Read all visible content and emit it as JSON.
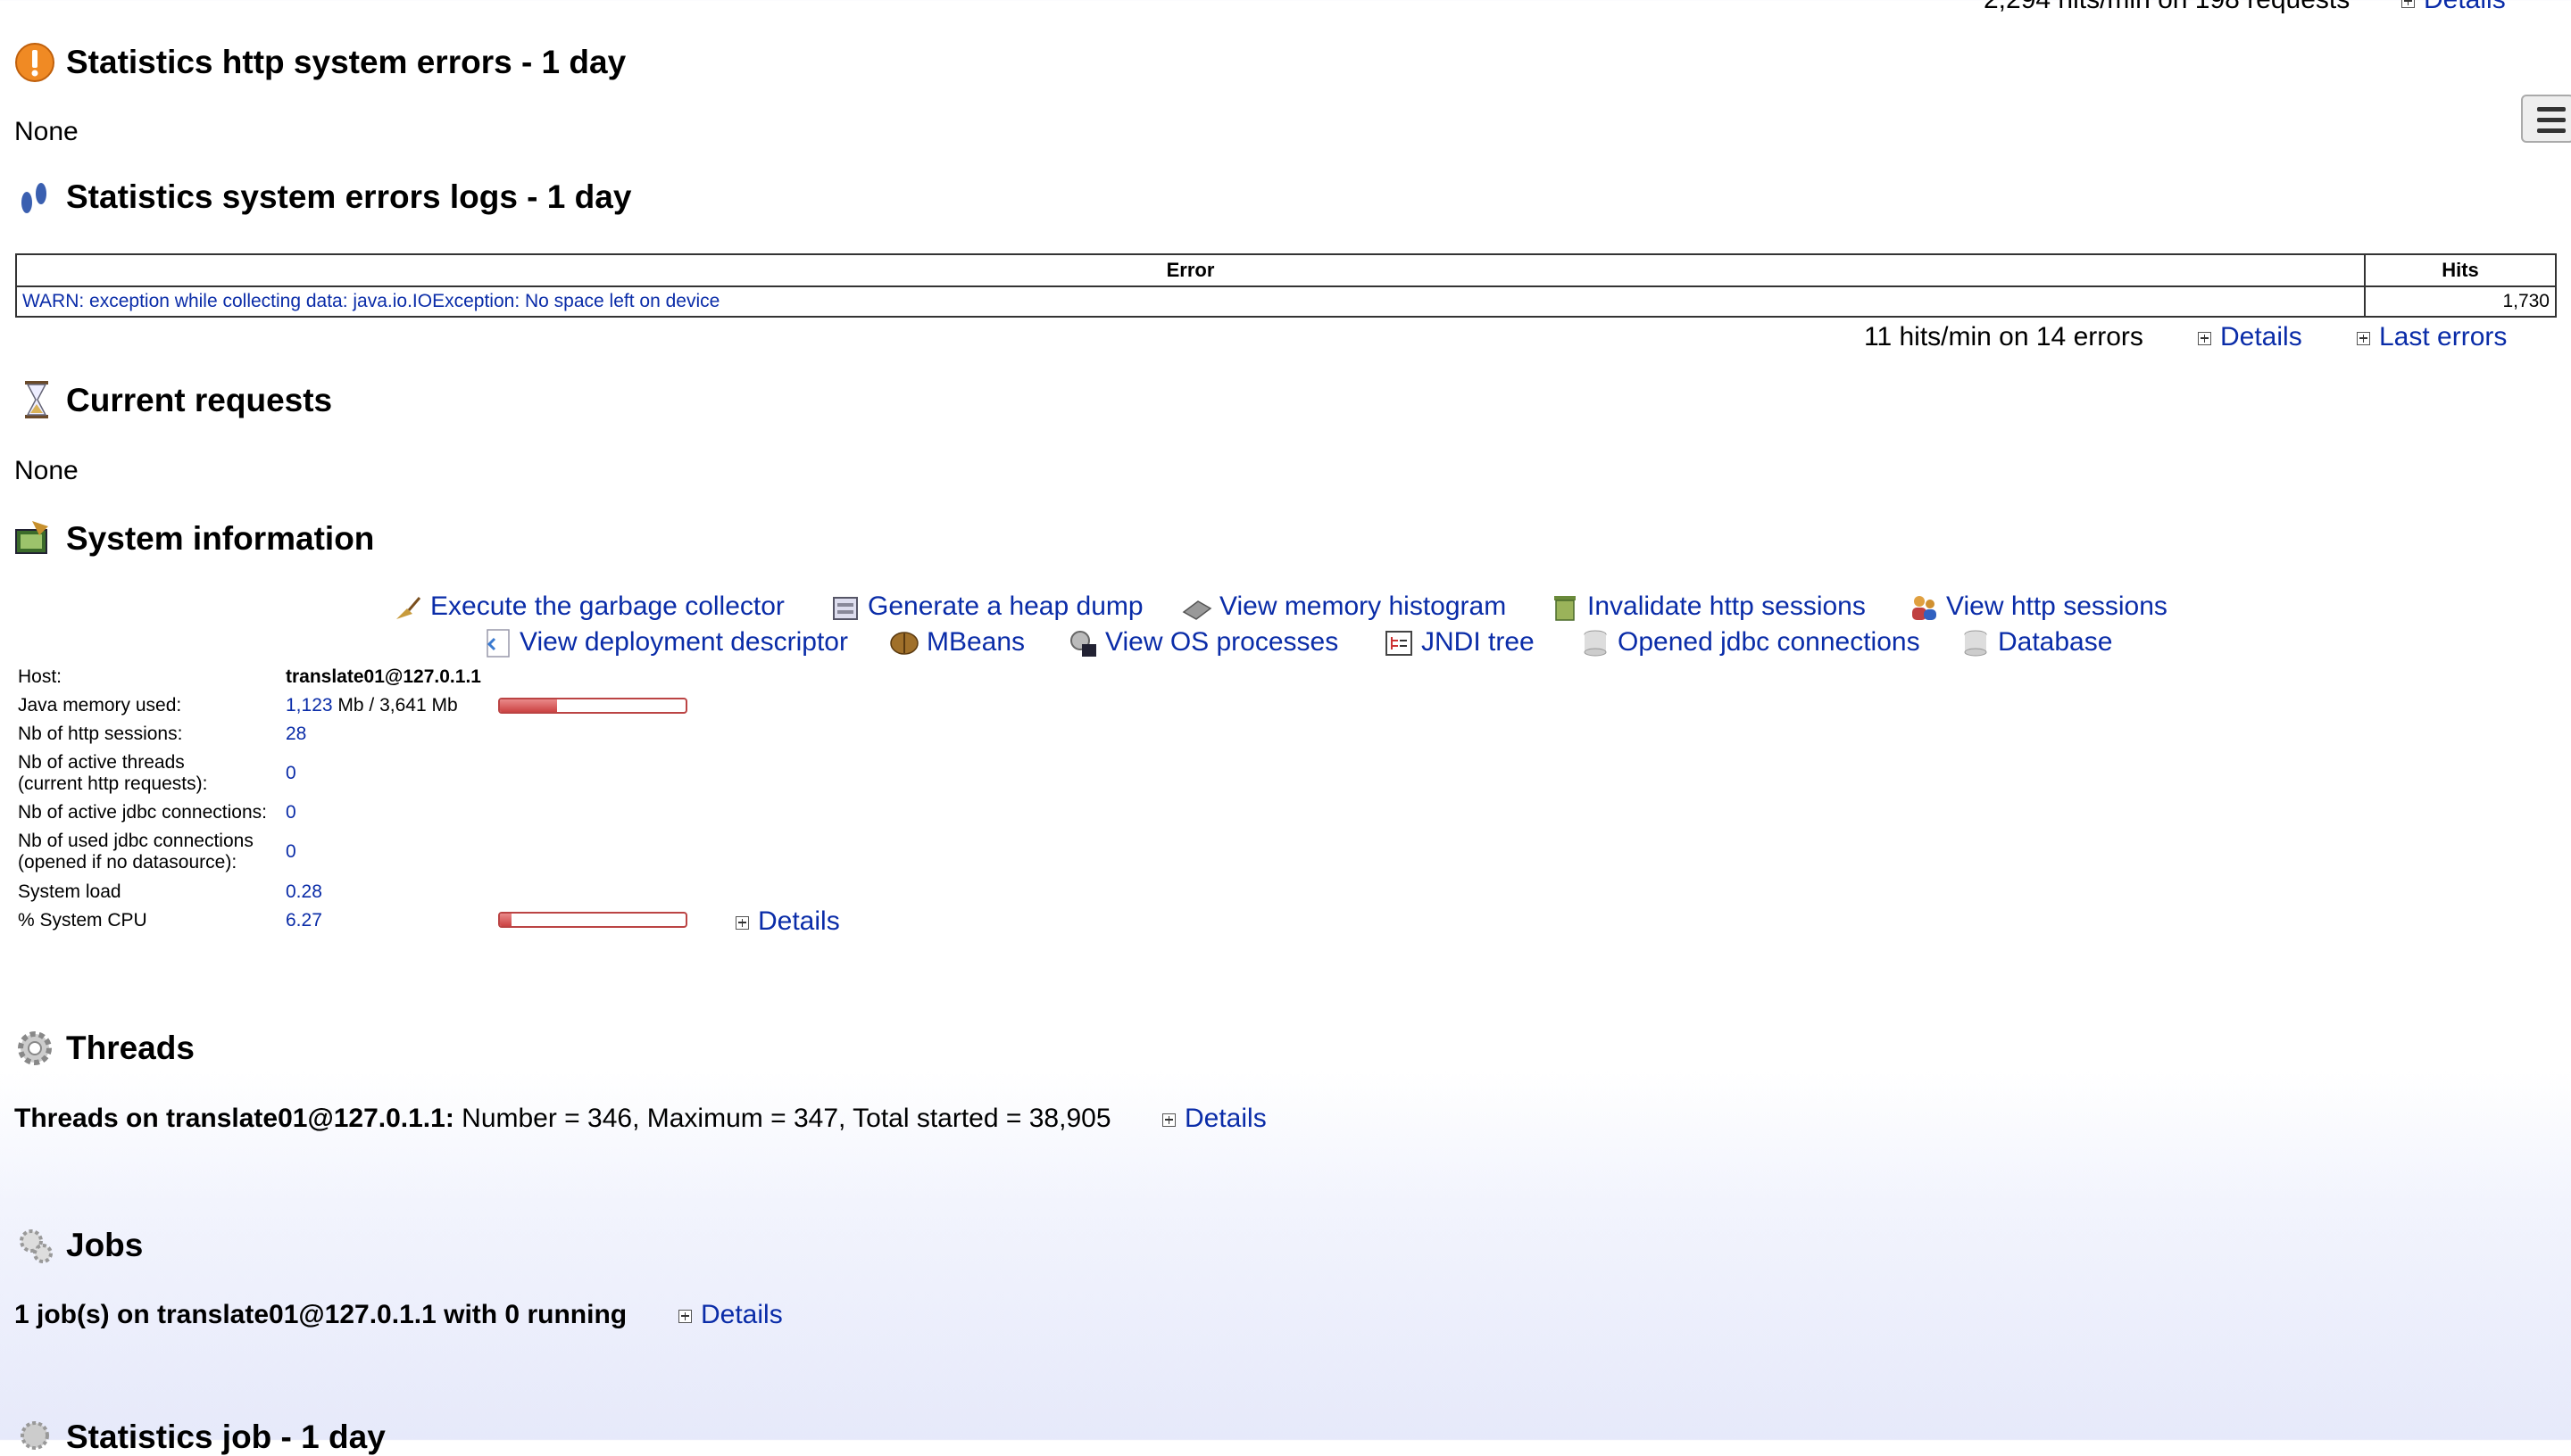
{
  "top": {
    "summary": "2,294 hits/min on 198 requests",
    "details": "Details"
  },
  "http_errors": {
    "title": "Statistics http system errors - 1 day",
    "body": "None"
  },
  "error_logs": {
    "title": "Statistics system errors logs - 1 day",
    "headers": {
      "error": "Error",
      "hits": "Hits"
    },
    "rows": [
      {
        "error": "WARN: exception while collecting data: java.io.IOException: No space left on device",
        "hits": "1,730"
      }
    ],
    "summary": "11 hits/min on 14 errors",
    "details": "Details",
    "last_errors": "Last errors"
  },
  "current_requests": {
    "title": "Current requests",
    "body": "None"
  },
  "system_info": {
    "title": "System information",
    "actions_row1": [
      "Execute the garbage collector",
      "Generate a heap dump",
      "View memory histogram",
      "Invalidate http sessions",
      "View http sessions"
    ],
    "actions_row2": [
      "View deployment descriptor",
      "MBeans",
      "View OS processes",
      "JNDI tree",
      "Opened jdbc connections",
      "Database"
    ],
    "host_label": "Host:",
    "host_value": "translate01@127.0.1.1",
    "mem_label": "Java memory used:",
    "mem_used": "1,123",
    "mem_total": " Mb / 3,641 Mb",
    "mem_fraction": 0.308,
    "sessions_label": "Nb of http sessions:",
    "sessions_value": "28",
    "threads_label_1": "Nb of active threads",
    "threads_label_2": "(current http requests):",
    "threads_value": "0",
    "jdbc_label": "Nb of active jdbc connections:",
    "jdbc_value": "0",
    "used_jdbc_label_1": "Nb of used jdbc connections",
    "used_jdbc_label_2": "(opened if no datasource):",
    "used_jdbc_value": "0",
    "load_label": "System load",
    "load_value": "0.28",
    "cpu_label": "% System CPU",
    "cpu_value": "6.27",
    "cpu_fraction": 0.0627,
    "details": "Details"
  },
  "threads": {
    "title": "Threads",
    "prefix": "Threads on translate01@127.0.1.1:",
    "text": " Number = 346, Maximum = 347, Total started = 38,905",
    "details": "Details"
  },
  "jobs": {
    "title": "Jobs",
    "text": "1 job(s) on translate01@127.0.1.1 with 0 running",
    "details": "Details"
  },
  "stats_job": {
    "title": "Statistics job - 1 day"
  },
  "colors": {
    "link": "#0a2ca8",
    "bar": "#cc4444"
  }
}
